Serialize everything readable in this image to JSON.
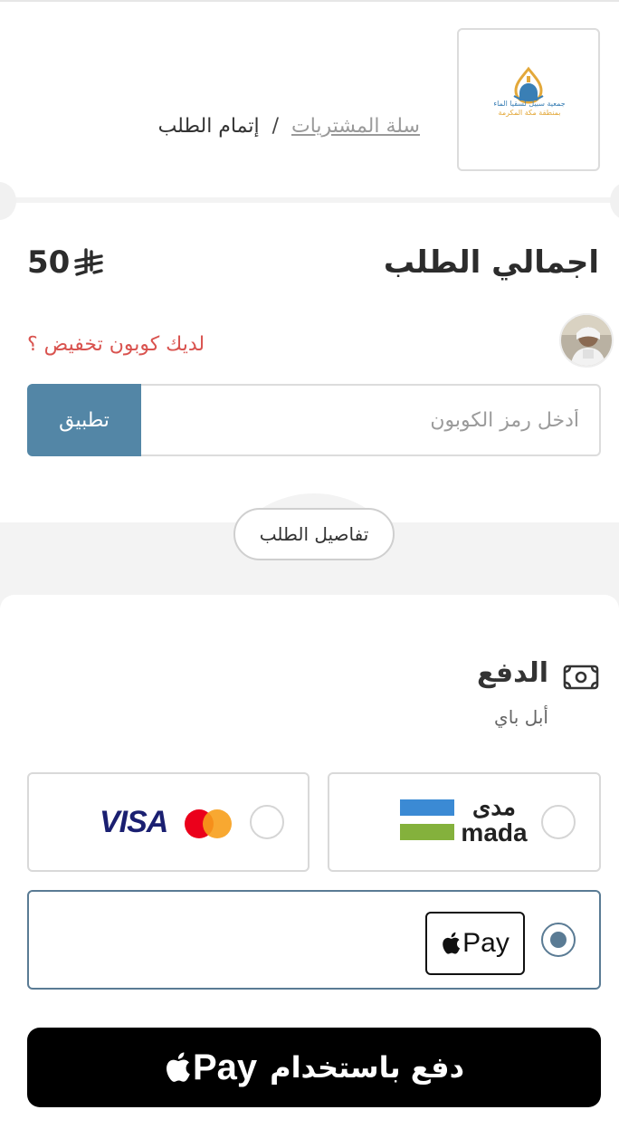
{
  "header": {
    "breadcrumb": {
      "cart_link": "سلة المشتريات",
      "separator": "/",
      "current": "إتمام الطلب"
    },
    "logo_text_line1": "جمعية سبيل لسقيا الماء",
    "logo_text_line2": "بمنطقة مكة المكرمة"
  },
  "order": {
    "total_label": "اجمالي الطلب",
    "total_amount": "50",
    "currency_icon": "saudi-riyal-icon"
  },
  "coupon": {
    "question": "لديك كوبون تخفيض ؟",
    "placeholder": "أدخل رمز الكوبون",
    "apply_label": "تطبيق"
  },
  "details_label": "تفاصيل الطلب",
  "payment": {
    "title": "الدفع",
    "subtitle": "أبل باي",
    "methods": [
      {
        "id": "mada",
        "label_ar": "مدى",
        "label_en": "mada",
        "selected": false
      },
      {
        "id": "card",
        "label_en": "VISA",
        "selected": false
      },
      {
        "id": "applepay",
        "label_en": "Pay",
        "selected": true
      }
    ],
    "pay_button_text": "دفع باستخدام",
    "pay_button_brand": "Pay"
  },
  "colors": {
    "primary": "#5386a6",
    "selected": "#5a7b94",
    "coupon_link": "#d9534f",
    "mada_blue": "#3b8ad4",
    "mada_green": "#84b13c",
    "visa_navy": "#1a1f71",
    "mc_red": "#eb001b",
    "mc_orange": "#f79e1b"
  }
}
